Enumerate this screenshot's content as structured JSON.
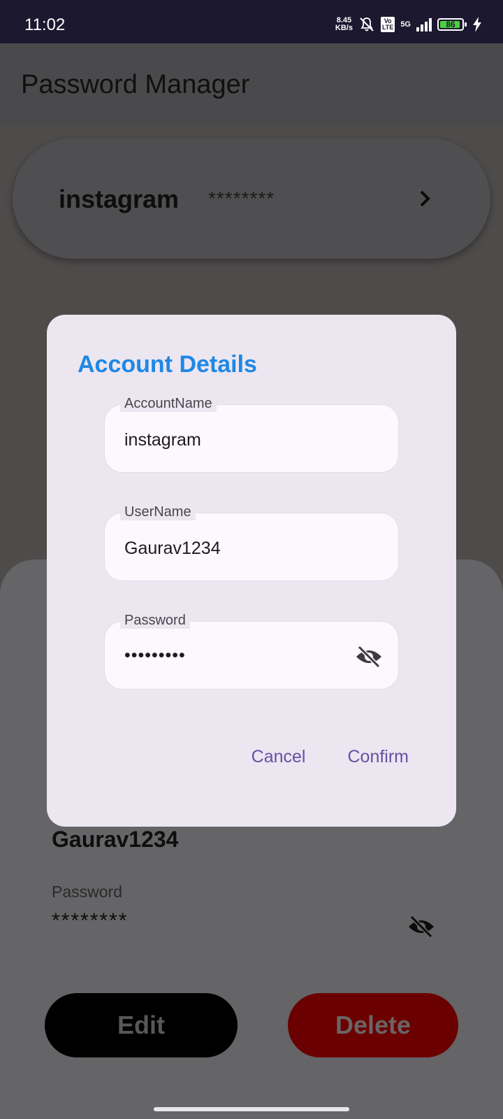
{
  "status_bar": {
    "time": "11:02",
    "speed_value": "8.45",
    "speed_unit": "KB/s",
    "volte_top": "Vo",
    "volte_bottom": "LTE",
    "network": "5G",
    "battery": "86"
  },
  "app_bar": {
    "title": "Password Manager"
  },
  "account_card": {
    "name": "instagram",
    "password_mask": "********",
    "chevron_icon": "chevron-right-icon"
  },
  "sheet": {
    "username": "Gaurav1234",
    "password_label": "Password",
    "password_mask": "********",
    "edit_label": "Edit",
    "delete_label": "Delete"
  },
  "dialog": {
    "title": "Account Details",
    "fields": [
      {
        "label": "AccountName",
        "value": "instagram"
      },
      {
        "label": "UserName",
        "value": "Gaurav1234"
      },
      {
        "label": "Password",
        "value": "•••••••••"
      }
    ],
    "cancel_label": "Cancel",
    "confirm_label": "Confirm"
  },
  "colors": {
    "accent": "#1e88e5",
    "dialog_action": "#6750a4",
    "delete_button": "#6b0000",
    "battery": "#4cd041"
  }
}
